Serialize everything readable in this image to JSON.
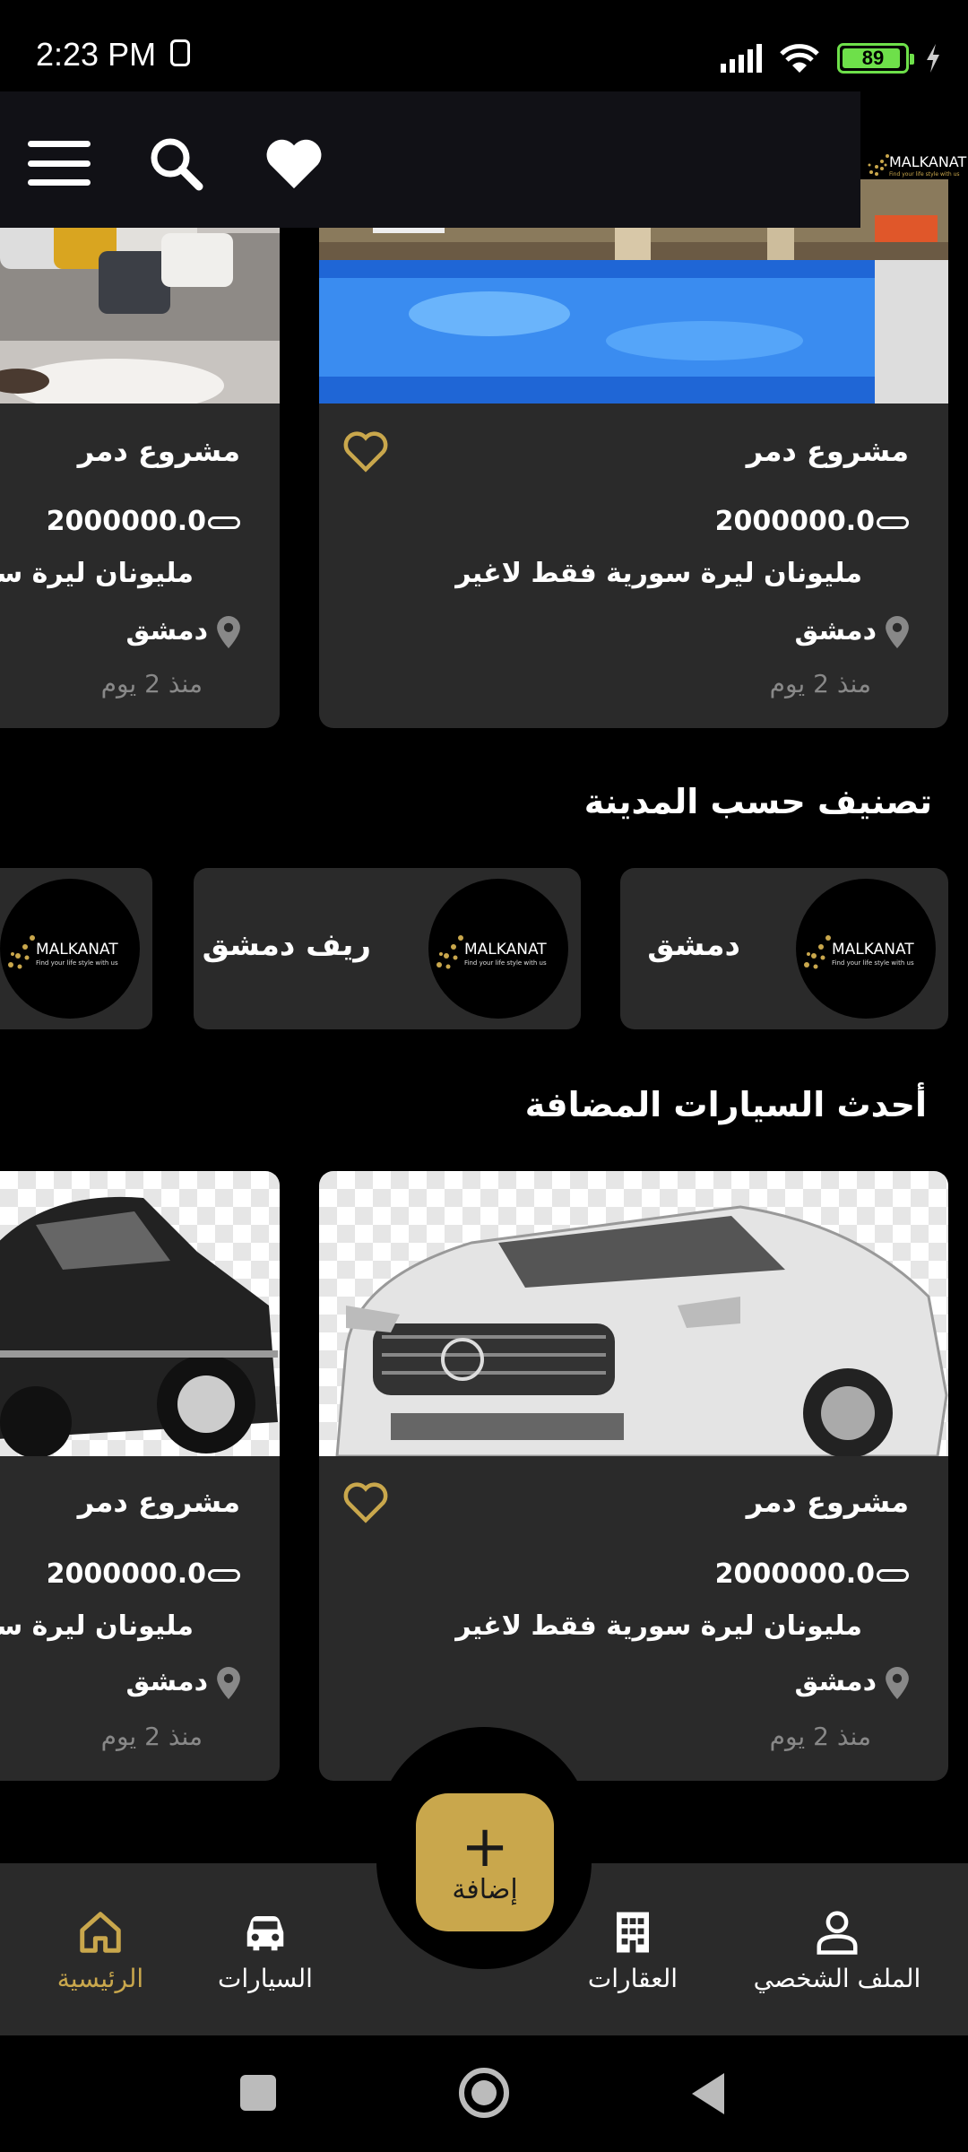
{
  "status_bar": {
    "time": "2:23 PM",
    "battery_level": "89"
  },
  "header": {
    "logo_text": "MALKANAT",
    "logo_tagline": "Find your life style with us"
  },
  "top_listings": [
    {
      "title": "مشروع دمر",
      "price": "2000000.0",
      "description": "مليونان ليرة سورية فقط لاغير",
      "city": "دمشق",
      "posted": "منذ 2 يوم"
    },
    {
      "title": "مشروع دمر",
      "price": "2000000.0",
      "description": "مليونان ليرة سورية فقط لاغير",
      "city": "دمشق",
      "posted": "منذ 2 يوم"
    }
  ],
  "city_section": {
    "title": "تصنيف حسب المدينة",
    "cities": [
      "دمشق",
      "ريف دمشق",
      ""
    ]
  },
  "cars_section": {
    "title": "أحدث السيارات المضافة",
    "listings": [
      {
        "title": "مشروع دمر",
        "price": "2000000.0",
        "description": "مليونان ليرة سورية فقط لاغير",
        "city": "دمشق",
        "posted": "منذ 2 يوم"
      },
      {
        "title": "مشروع دمر",
        "price": "2000000.0",
        "description": "مليونان ليرة سورية فقط لاغير",
        "city": "دمشق",
        "posted": "منذ 2 يوم"
      }
    ]
  },
  "bottom_nav": {
    "add_label": "إضافة",
    "items": [
      {
        "label": "الملف الشخصي",
        "icon": "person-icon"
      },
      {
        "label": "العقارات",
        "icon": "building-icon"
      },
      {
        "label": "السيارات",
        "icon": "car-icon"
      },
      {
        "label": "الرئيسية",
        "icon": "home-icon",
        "active": true
      }
    ]
  },
  "colors": {
    "accent": "#c9a74c",
    "card": "#2a2a2a",
    "background": "#000000"
  }
}
